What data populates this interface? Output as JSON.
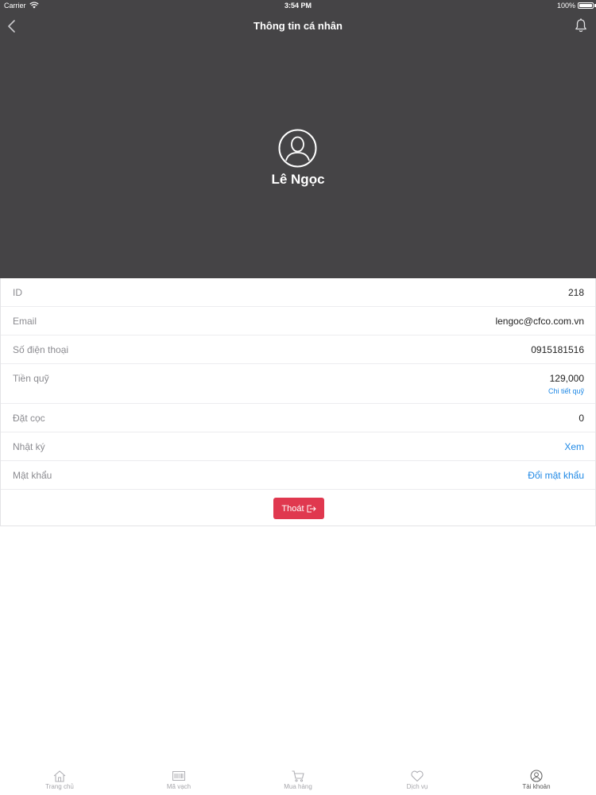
{
  "status_bar": {
    "carrier": "Carrier",
    "time": "3:54 PM",
    "battery": "100%"
  },
  "header": {
    "title": "Thông tin cá nhân",
    "back_icon": "chevron-left-icon",
    "bell_icon": "bell-icon"
  },
  "profile": {
    "name": "Lê Ngọc",
    "avatar_icon": "user-avatar-icon"
  },
  "info": {
    "id": {
      "label": "ID",
      "value": "218"
    },
    "email": {
      "label": "Email",
      "value": "lengoc@cfco.com.vn"
    },
    "phone": {
      "label": "Số điện thoại",
      "value": "0915181516"
    },
    "fund": {
      "label": "Tiền quỹ",
      "value": "129,000",
      "link": "Chi tiết quỹ"
    },
    "deposit": {
      "label": "Đặt cọc",
      "value": "0"
    },
    "log": {
      "label": "Nhật ký",
      "link": "Xem"
    },
    "password": {
      "label": "Mật khẩu",
      "link": "Đổi mật khẩu"
    }
  },
  "logout": {
    "label": "Thoát",
    "icon": "logout-icon"
  },
  "tabbar": {
    "items": [
      {
        "label": "Trang chủ",
        "icon": "home-icon"
      },
      {
        "label": "Mã vạch",
        "icon": "barcode-icon"
      },
      {
        "label": "Mua hàng",
        "icon": "cart-icon"
      },
      {
        "label": "Dịch vụ",
        "icon": "heart-icon"
      },
      {
        "label": "Tài khoản",
        "icon": "account-icon",
        "active": true
      }
    ]
  },
  "colors": {
    "header_bg": "#454446",
    "accent_link": "#1e88e5",
    "logout_button": "#e0384f"
  }
}
